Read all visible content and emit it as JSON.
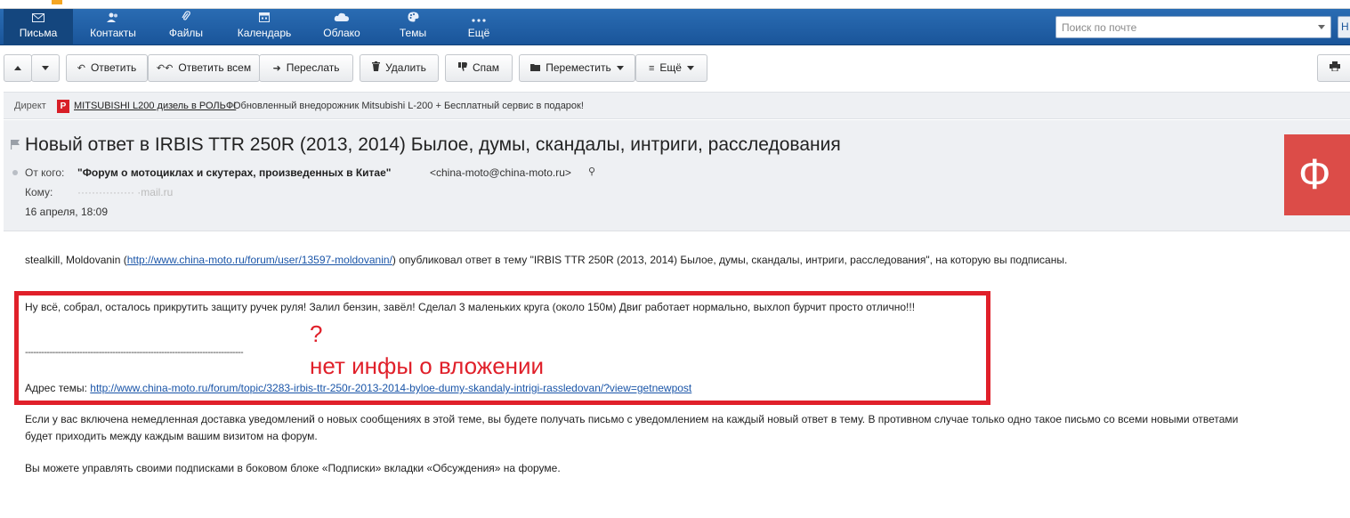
{
  "nav": {
    "items": [
      {
        "label": "Письма",
        "icon": "envelope-icon"
      },
      {
        "label": "Контакты",
        "icon": "contacts-icon"
      },
      {
        "label": "Файлы",
        "icon": "paperclip-icon"
      },
      {
        "label": "Календарь",
        "icon": "calendar-icon"
      },
      {
        "label": "Облако",
        "icon": "cloud-icon"
      },
      {
        "label": "Темы",
        "icon": "palette-icon"
      },
      {
        "label": "Ещё",
        "icon": "more-dots-icon"
      }
    ],
    "search_placeholder": "Поиск по почте",
    "search_button_label": "Н",
    "colors": {
      "bar": "#1a559a",
      "active": "#14467e"
    }
  },
  "toolbar": {
    "reply": "Ответить",
    "reply_all": "Ответить всем",
    "forward": "Переслать",
    "delete": "Удалить",
    "spam": "Спам",
    "move": "Переместить",
    "more": "Ещё"
  },
  "ad": {
    "direct": "Директ",
    "logo_letter": "P",
    "link": "MITSUBISHI L200 дизель в РОЛЬФ!",
    "text": "Обновленный внедорожник Mitsubishi L-200 + Бесплатный сервис в подарок!"
  },
  "message": {
    "subject": "Новый ответ в IRBIS TTR 250R (2013, 2014) Былое, думы, скандалы, интриги, расследования",
    "from_label": "От кого:",
    "from_name": "\"Форум о мотоциклах и скутерах, произведенных в Китае\"",
    "from_address": "<china-moto@china-moto.ru>",
    "to_label": "Кому:",
    "to_address": "················ ·mail.ru",
    "date": "16 апреля, 18:09",
    "avatar_letter": "Ф",
    "avatar_color": "#dc4c48"
  },
  "body": {
    "intro_prefix": "stealkill, Moldovanin (",
    "intro_link": "http://www.china-moto.ru/forum/user/13597-moldovanin/",
    "intro_suffix": ") опубликовал ответ в тему \"IRBIS TTR 250R (2013, 2014) Былое, думы, скандалы, интриги, расследования\", на которую вы подписаны.",
    "post_text": "Ну всё, собрал, осталось прикрутить защиту ручек руля! Залил бензин, завёл! Сделал 3 маленьких круга (около 150м) Двиг работает нормально, выхлоп бурчит просто отлично!!!",
    "divider": "--------------------------------------------------------------------------------",
    "topic_label": "Адрес темы:",
    "topic_link": "http://www.china-moto.ru/forum/topic/3283-irbis-ttr-250r-2013-2014-byloe-dumy-skandaly-intrigi-rassledovan/?view=getnewpost",
    "notice_line1": "Если у вас включена немедленная доставка уведомлений о новых сообщениях в этой теме, вы будете получать письмо с уведомлением на каждый новый ответ в тему. В противном случае только одно такое письмо со всеми новыми ответами",
    "notice_line2": "будет приходить между каждым вашим визитом на форум.",
    "manage": "Вы можете управлять своими подписками в боковом блоке «Подписки» вкладки «Обсуждения» на форуме."
  },
  "annotation": {
    "question": "?",
    "text": "нет инфы о вложении",
    "color": "#e0202a"
  }
}
